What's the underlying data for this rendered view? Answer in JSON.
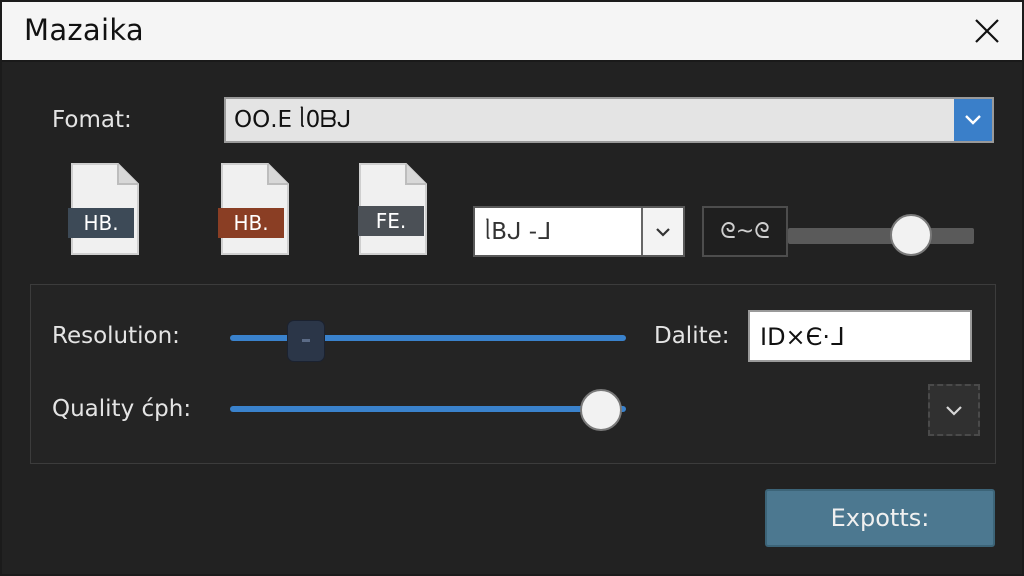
{
  "window": {
    "title": "Mazaika",
    "close_icon": "close-icon"
  },
  "format": {
    "label": "Fomat:",
    "value": "ՕՕ.Ε ᥣ0ᗷᒍ",
    "arrow_icon": "chevron-down-icon"
  },
  "file_icons": [
    {
      "name": "file-icon-hb-dark",
      "label": "HB.",
      "label_color": "#3d4a57"
    },
    {
      "name": "file-icon-hb-brown",
      "label": "HB.",
      "label_color": "#8a3e24"
    },
    {
      "name": "file-icon-fe",
      "label": "FE.",
      "label_color": "#4b5056"
    }
  ],
  "preset_select": {
    "value": "ᥣBᒍ -ᒧ",
    "arrow_icon": "chevron-down-icon"
  },
  "toggle": {
    "text": "ᘓ~ᘓ"
  },
  "resolution": {
    "label": "Resolution:"
  },
  "dalite": {
    "label": "Dalite:",
    "value": "ID×Є·ᒧ"
  },
  "quality": {
    "label": "Quality ćph:"
  },
  "export_button": {
    "label": "Expotts:"
  },
  "colors": {
    "accent": "#3a82cc",
    "export": "#4c7890",
    "background": "#222222"
  }
}
